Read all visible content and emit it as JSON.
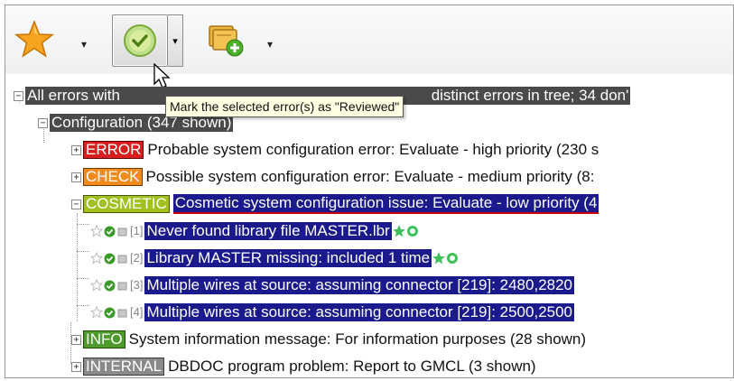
{
  "toolbar": {
    "buttons": [
      {
        "name": "star",
        "icon": "star-icon",
        "has_dropdown": true
      },
      {
        "name": "reviewed",
        "icon": "check-circle-icon",
        "has_dropdown": true,
        "pressed": true
      },
      {
        "name": "add-comment",
        "icon": "package-add-icon",
        "has_dropdown": true
      }
    ],
    "dropdown_glyph": "▾"
  },
  "tooltip": {
    "text": "Mark the selected error(s) as \"Reviewed\""
  },
  "tree": {
    "root": {
      "expander": "−",
      "label": "All errors with ",
      "label_tail": "distinct errors in tree; 34 don'"
    },
    "configuration": {
      "expander": "−",
      "label": "Configuration (347 shown)"
    },
    "categories": [
      {
        "expander": "+",
        "tag": "ERROR",
        "text": "Probable system configuration error: Evaluate - high priority (230 s"
      },
      {
        "expander": "+",
        "tag": "CHECK",
        "text": "Possible system configuration error: Evaluate - medium priority (8:"
      },
      {
        "expander": "−",
        "tag": "COSMETIC",
        "text": "Cosmetic system configuration issue: Evaluate - low priority (4"
      }
    ],
    "leaves": [
      {
        "index": "[1]",
        "text": "Never found library file MASTER.lbr",
        "flags": true
      },
      {
        "index": "[2]",
        "text": "Library MASTER missing: included 1 time",
        "flags": true
      },
      {
        "index": "[3]",
        "text": "Multiple wires at source: assuming connector [219]: 2480,2820",
        "flags": false
      },
      {
        "index": "[4]",
        "text": "Multiple wires at source: assuming connector [219]: 2500,2500",
        "flags": false
      }
    ],
    "bottom_categories": [
      {
        "expander": "+",
        "tag": "INFO",
        "text": "System information message: For information purposes (28 shown)"
      },
      {
        "expander": "+",
        "tag": "INTERNAL",
        "text": "DBDOC program problem: Report to GMCL (3 shown)"
      }
    ]
  },
  "colors": {
    "error": "#d81e1e",
    "check": "#f28a1c",
    "cosmetic": "#a2c020",
    "info": "#4e9a2c",
    "internal": "#8a8a8a",
    "selection": "#1a1a8c"
  }
}
